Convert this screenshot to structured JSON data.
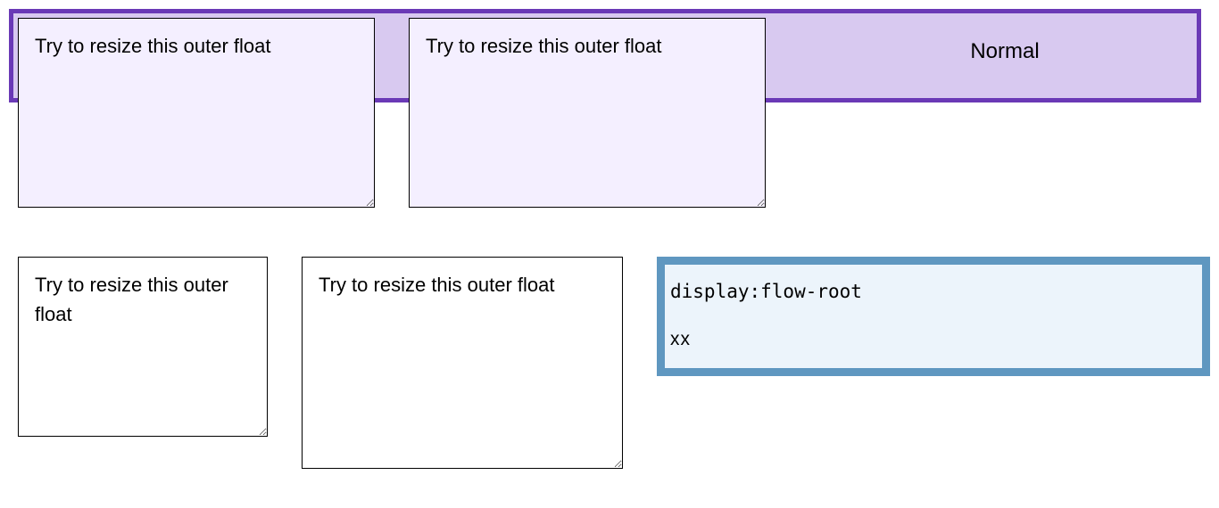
{
  "row1": {
    "box1_text": "Try to resize this outer float",
    "box2_text": "Try to resize this outer float",
    "normal_label": "Normal"
  },
  "row2": {
    "box1_text": "Try to resize this outer float",
    "box2_text": "Try to resize this outer float",
    "info": {
      "line1": "display:flow-root",
      "line2": "xx"
    }
  }
}
